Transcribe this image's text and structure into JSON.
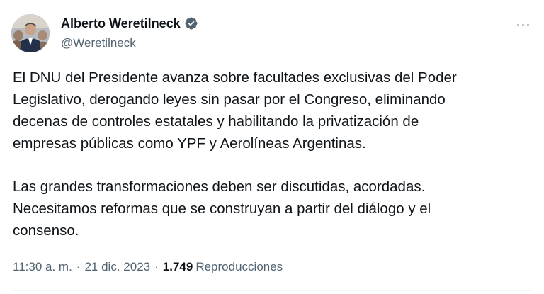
{
  "author": {
    "display_name": "Alberto Weretilneck",
    "handle": "@Weretilneck",
    "verified_icon": "verified-badge",
    "verified_color": "#536471"
  },
  "menu": {
    "more_label": "···"
  },
  "tweet": {
    "paragraphs": [
      "El DNU del Presidente avanza sobre facultades exclusivas del Poder\nLegislativo, derogando leyes sin pasar por el Congreso, eliminando\ndecenas de controles estatales y habilitando la privatización de\nempresas públicas como YPF y Aerolíneas Argentinas.",
      "Las grandes transformaciones deben ser discutidas, acordadas.\nNecesitamos reformas que se construyan a partir del diálogo y el\nconsenso."
    ]
  },
  "meta": {
    "time": "11:30 a. m.",
    "separator": "·",
    "date": "21 dic. 2023",
    "views_count": "1.749",
    "views_label": "Reproducciones"
  },
  "colors": {
    "text": "#0f1419",
    "secondary": "#536471",
    "divider": "#eff3f4"
  }
}
